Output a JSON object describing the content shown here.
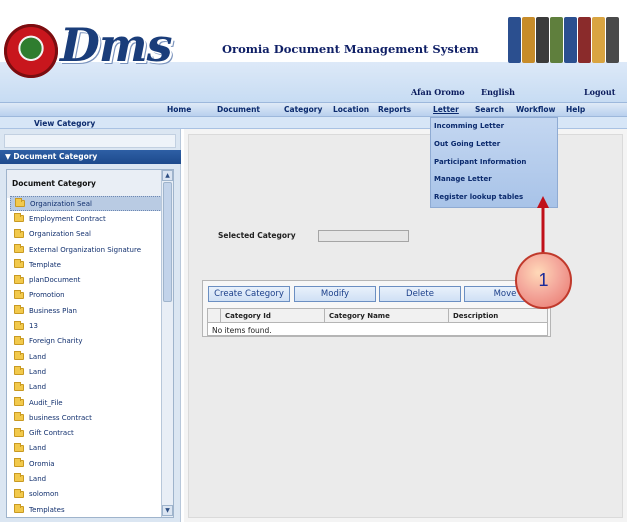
{
  "header": {
    "logo_text": "Dms",
    "system_title": "Oromia Document Management System",
    "links": {
      "afan_oromo": "Afan Oromo",
      "english": "English",
      "logout": "Logout"
    }
  },
  "nav": {
    "items": [
      "Home",
      "Document",
      "Category",
      "Location",
      "Reports",
      "Letter",
      "Search",
      "Workflow",
      "Help"
    ]
  },
  "subbar": {
    "view_category": "View Category"
  },
  "letter_menu": {
    "items": [
      "Incomming Letter",
      "Out Going Letter",
      "Participant Information",
      "Manage Letter",
      "Register lookup tables"
    ]
  },
  "left_panel": {
    "section_header": "▼ Document Category",
    "tree_heading": "Document Category",
    "items": [
      "Organization Seal",
      "Employment Contract",
      "Organization Seal",
      "External Organization Signature",
      "Template",
      "planDocument",
      "Promotion",
      "Business Plan",
      "13",
      "Foreign Charity",
      "Land",
      "Land",
      "Land",
      "Audit_File",
      "business Contract",
      "Gift Contract",
      "Land",
      "Oromia",
      "Land",
      "solomon",
      "Templates"
    ],
    "selected_index": 0
  },
  "main": {
    "selected_category_label": "Selected Category",
    "selected_category_value": "",
    "buttons": {
      "create": "Create Category",
      "modify": "Modify",
      "delete": "Delete",
      "move": "Move"
    },
    "columns": [
      "",
      "Category Id",
      "Category Name",
      "Description"
    ],
    "empty_text": "No items found."
  },
  "annotation": {
    "number": "1"
  },
  "colors": {
    "nav_text": "#0b2a6d",
    "menu_bg": "#b6cdec",
    "callout_border": "#c0392b",
    "arrow": "#c0101a"
  }
}
